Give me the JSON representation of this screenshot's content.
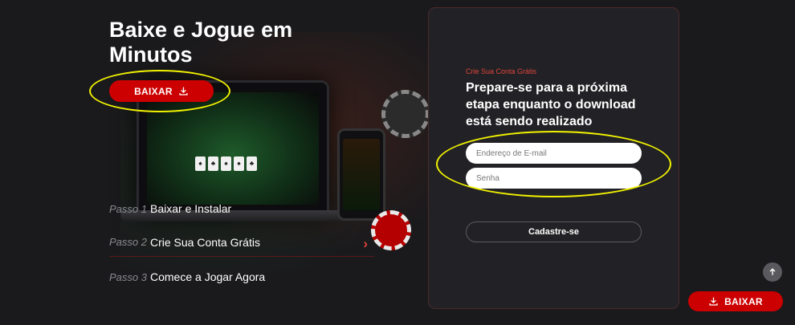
{
  "hero": {
    "title": "Baixe e Jogue em Minutos",
    "download_label": "BAIXAR"
  },
  "steps": [
    {
      "number": "Passo 1",
      "label": "Baixar e Instalar"
    },
    {
      "number": "Passo 2",
      "label": "Crie Sua Conta Grátis"
    },
    {
      "number": "Passo 3",
      "label": "Comece a Jogar Agora"
    }
  ],
  "signup": {
    "kicker": "Crie Sua Conta Grátis",
    "heading": "Prepare-se para a próxima etapa enquanto o download está sendo realizado",
    "email_placeholder": "Endereço de E-mail",
    "email_value": "",
    "password_placeholder": "Senha",
    "password_value": "",
    "submit_label": "Cadastre-se"
  },
  "floating": {
    "download_label": "BAIXAR",
    "scroll_top_icon": "arrow-up-icon"
  },
  "icons": {
    "download": "download-icon",
    "chevron": "chevron-right-icon"
  },
  "colors": {
    "background": "#1a1a1d",
    "accent": "#cc0000",
    "kicker": "#e0443a",
    "highlight": "#f2f200"
  }
}
